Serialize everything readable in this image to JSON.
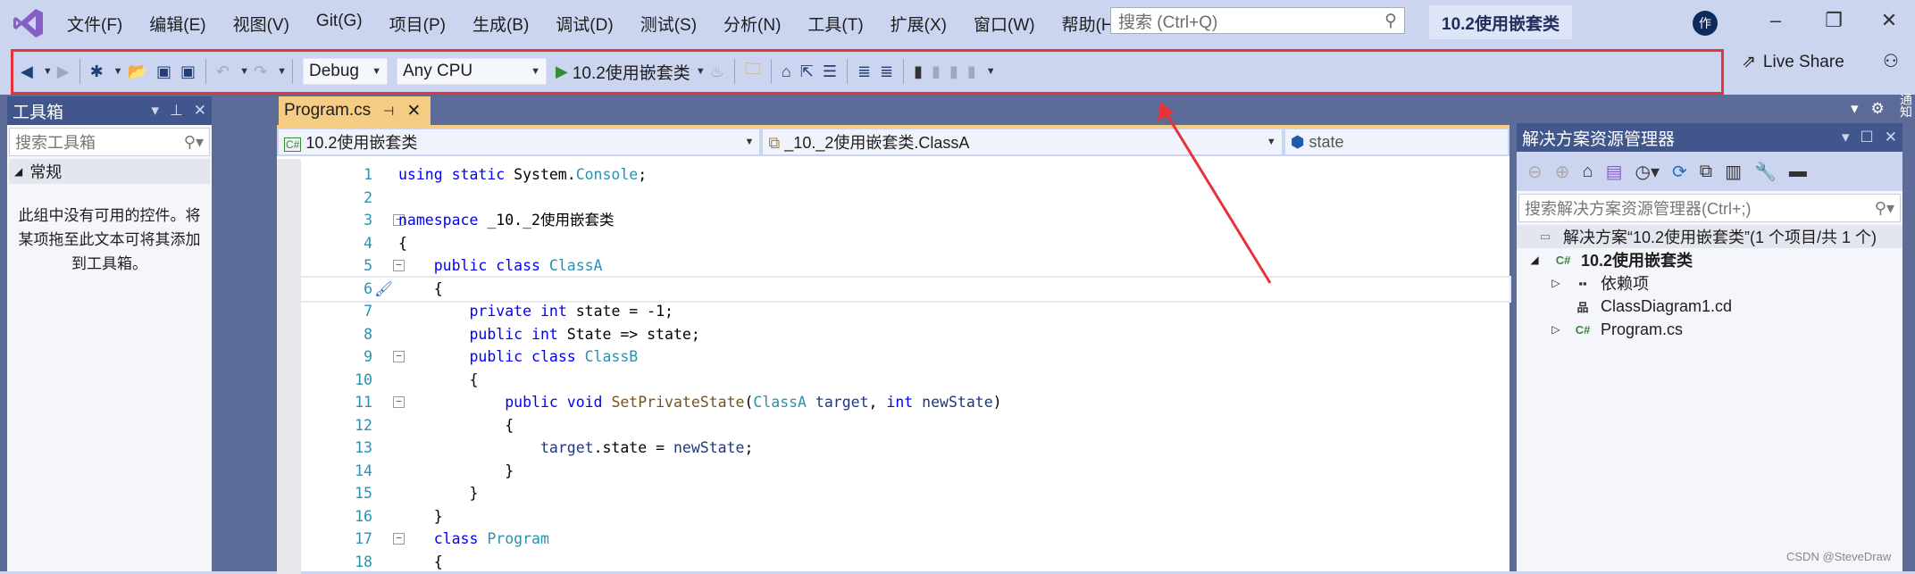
{
  "menu": [
    "文件(F)",
    "编辑(E)",
    "视图(V)",
    "Git(G)",
    "项目(P)",
    "生成(B)",
    "调试(D)",
    "测试(S)",
    "分析(N)",
    "工具(T)",
    "扩展(X)",
    "窗口(W)",
    "帮助(H)"
  ],
  "search": {
    "placeholder": "搜索 (Ctrl+Q)"
  },
  "solution_title": "10.2使用嵌套类",
  "avatar": "作",
  "toolbar": {
    "config": "Debug",
    "platform": "Any CPU",
    "start": "10.2使用嵌套类",
    "live_share": "Live Share"
  },
  "toolbox": {
    "title": "工具箱",
    "search_placeholder": "搜索工具箱",
    "group": "常规",
    "empty": "此组中没有可用的控件。将某项拖至此文本可将其添加到工具箱。"
  },
  "editor": {
    "tab": "Program.cs",
    "nav_project": "10.2使用嵌套类",
    "nav_type": "_10._2使用嵌套类.ClassA",
    "nav_member": "state",
    "lines": [
      [
        [
          "kw",
          "using static "
        ],
        [
          "pl",
          "System."
        ],
        [
          "ty",
          "Console"
        ],
        [
          "pl",
          ";"
        ]
      ],
      [],
      [
        [
          "kw",
          "namespace "
        ],
        [
          "pl",
          "_10._2使用嵌套类"
        ]
      ],
      [
        [
          "pl",
          "{"
        ]
      ],
      [
        [
          "pl",
          "    "
        ],
        [
          "kw",
          "public class "
        ],
        [
          "ty",
          "ClassA"
        ]
      ],
      [
        [
          "pl",
          "    {"
        ]
      ],
      [
        [
          "pl",
          "        "
        ],
        [
          "kw",
          "private int "
        ],
        [
          "pl",
          "state = -1;"
        ]
      ],
      [
        [
          "pl",
          "        "
        ],
        [
          "kw",
          "public int "
        ],
        [
          "pl",
          "State => state;"
        ]
      ],
      [
        [
          "pl",
          "        "
        ],
        [
          "kw",
          "public class "
        ],
        [
          "ty",
          "ClassB"
        ]
      ],
      [
        [
          "pl",
          "        {"
        ]
      ],
      [
        [
          "pl",
          "            "
        ],
        [
          "kw",
          "public void "
        ],
        [
          "me",
          "SetPrivateState"
        ],
        [
          "pl",
          "("
        ],
        [
          "ty",
          "ClassA"
        ],
        [
          "va",
          " target"
        ],
        [
          "pl",
          ", "
        ],
        [
          "kw",
          "int"
        ],
        [
          "va",
          " newState"
        ],
        [
          "pl",
          ")"
        ]
      ],
      [
        [
          "pl",
          "            {"
        ]
      ],
      [
        [
          "pl",
          "                "
        ],
        [
          "va",
          "target"
        ],
        [
          "pl",
          ".state = "
        ],
        [
          "va",
          "newState"
        ],
        [
          "pl",
          ";"
        ]
      ],
      [
        [
          "pl",
          "            }"
        ]
      ],
      [
        [
          "pl",
          "        }"
        ]
      ],
      [
        [
          "pl",
          "    }"
        ]
      ],
      [
        [
          "pl",
          "    "
        ],
        [
          "kw",
          "class "
        ],
        [
          "ty",
          "Program"
        ]
      ],
      [
        [
          "pl",
          "    {"
        ]
      ]
    ]
  },
  "solution_explorer": {
    "title": "解决方案资源管理器",
    "search_placeholder": "搜索解决方案资源管理器(Ctrl+;)",
    "solution": "解决方案“10.2使用嵌套类”(1 个项目/共 1 个)",
    "project": "10.2使用嵌套类",
    "items": [
      "依赖项",
      "ClassDiagram1.cd",
      "Program.cs"
    ]
  },
  "notifications": "通知",
  "watermark": "CSDN @SteveDraw",
  "colors": {
    "accent": "#40568d",
    "tab_active": "#f5cc84",
    "annotation": "#e8323a"
  }
}
